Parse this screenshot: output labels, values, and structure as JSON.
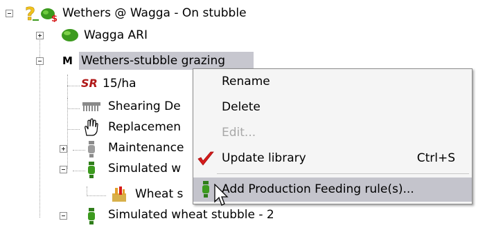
{
  "tree": {
    "root": {
      "label": "Wethers @ Wagga - On stubble"
    },
    "wagga": {
      "label": "Wagga ARI"
    },
    "wethers": {
      "badge": "M",
      "label": "Wethers-stubble grazing"
    },
    "sr": {
      "badge": "SR",
      "label": "15/ha"
    },
    "shearing": {
      "label": "Shearing De"
    },
    "replacement": {
      "label": "Replacemen"
    },
    "maintenance": {
      "label": "Maintenance"
    },
    "simulated1": {
      "label": "Simulated w"
    },
    "wheat": {
      "label": "Wheat s"
    },
    "simulated2": {
      "label": "Simulated wheat stubble - 2"
    }
  },
  "context_menu": {
    "items": [
      {
        "label": "Rename",
        "shortcut": "",
        "enabled": true
      },
      {
        "label": "Delete",
        "shortcut": "",
        "enabled": true
      },
      {
        "label": "Edit...",
        "shortcut": "",
        "enabled": false
      },
      {
        "label": "Update library",
        "shortcut": "Ctrl+S",
        "enabled": true,
        "checked": true
      },
      {
        "label": "Add Production Feeding rule(s)...",
        "shortcut": "",
        "enabled": true,
        "highlighted": true
      }
    ]
  },
  "colors": {
    "selection": "#c7c7cf",
    "menu_background": "#f5f5f5",
    "menu_highlight": "#c4c4cc",
    "checkmark": "#d61b1b",
    "sr_badge": "#b01818",
    "folder_green": "#3c9a1e",
    "question_yellow": "#f2c21b"
  }
}
